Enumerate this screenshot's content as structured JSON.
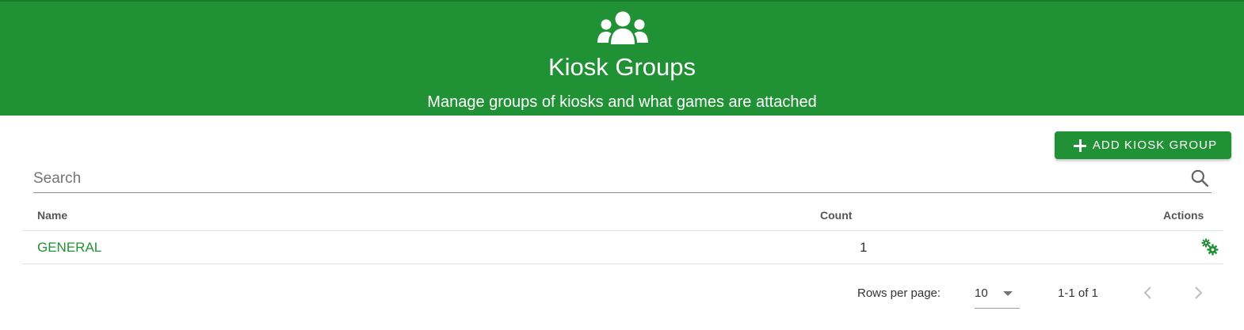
{
  "header": {
    "icon": "users-group-icon",
    "title": "Kiosk Groups",
    "subtitle": "Manage groups of kiosks and what games are attached",
    "background_color": "#219135"
  },
  "toolbar": {
    "add_button_label": "ADD KIOSK GROUP",
    "add_button_icon": "plus-icon"
  },
  "search": {
    "placeholder": "Search",
    "value": "",
    "icon": "search-icon"
  },
  "table": {
    "columns": [
      "Name",
      "Count",
      "Actions"
    ],
    "rows": [
      {
        "name": "GENERAL",
        "count": "1",
        "action_icon": "gears-icon"
      }
    ]
  },
  "pagination": {
    "rows_per_page_label": "Rows per page:",
    "rows_per_page_value": "10",
    "range": "1-1 of 1"
  },
  "colors": {
    "accent": "#219135",
    "text": "#333333"
  }
}
